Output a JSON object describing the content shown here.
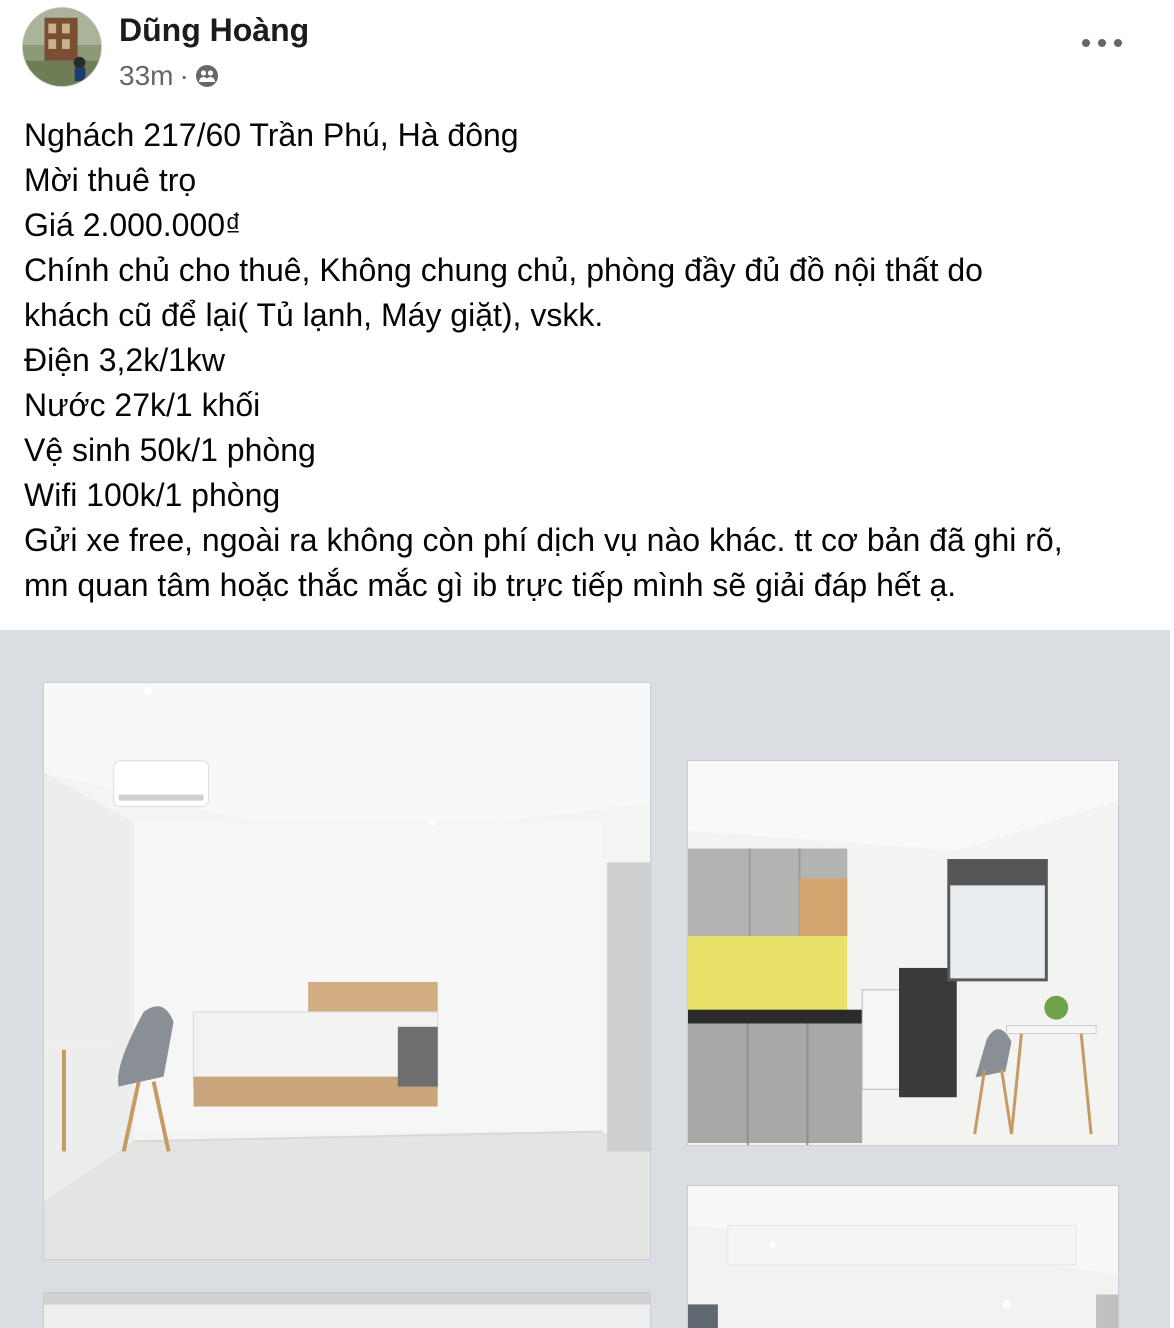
{
  "post": {
    "author": "Dũng Hoàng",
    "time": "33m",
    "separator": "·",
    "audience_icon": "friends-icon",
    "more_icon": "more-options-icon"
  },
  "content": {
    "lines": [
      "Nghách 217/60 Trần Phú, Hà đông",
      "Mời thuê trọ",
      "Giá 2.000.000₫",
      "Chính chủ cho thuê, Không chung chủ, phòng đầy đủ đồ nội thất do\nkhách cũ để lại( Tủ lạnh, Máy giặt), vskk.",
      "Điện 3,2k/1kw",
      "Nước 27k/1 khối",
      "Vệ sinh 50k/1 phòng",
      "Wifi 100k/1 phòng",
      "Gửi xe free, ngoài ra không còn phí dịch vụ nào khác. tt cơ bản đã ghi rõ,\nmn quan tâm hoặc thắc mắc gì ib trực tiếp mình sẽ giải đáp hết ạ."
    ]
  },
  "photos": [
    {
      "subject": "bedroom-photo"
    },
    {
      "subject": "kitchen-photo"
    },
    {
      "subject": "room-photo"
    },
    {
      "subject": "room-photo"
    }
  ]
}
